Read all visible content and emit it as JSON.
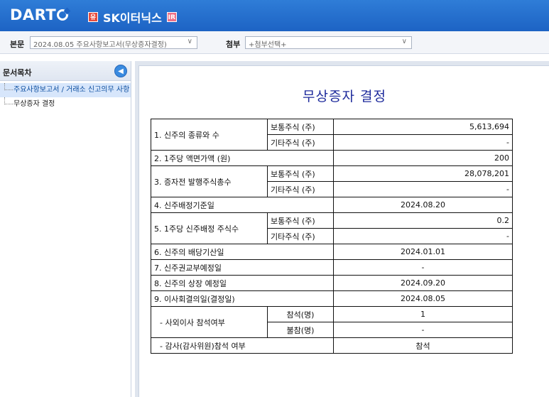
{
  "header": {
    "logo": "DART",
    "company": "SK이터닉스",
    "badge_left": "유",
    "badge_right": "IR"
  },
  "toolbar": {
    "main_label": "본문",
    "main_select": "2024.08.05  주요사항보고서(무상증자결정)",
    "attach_label": "첨부",
    "attach_select": "+첨부선택+"
  },
  "sidebar": {
    "title": "문서목차",
    "items": [
      {
        "label": "주요사항보고서 / 거래소 신고의무 사항"
      },
      {
        "label": "무상증자 결정"
      }
    ]
  },
  "document": {
    "title": "무상증자 결정",
    "rows": {
      "r1": {
        "label": "1. 신주의 종류와 수",
        "a_label": "보통주식 (주)",
        "a_val": "5,613,694",
        "b_label": "기타주식 (주)",
        "b_val": "-"
      },
      "r2": {
        "label": "2. 1주당 액면가액 (원)",
        "val": "200"
      },
      "r3": {
        "label": "3. 증자전 발행주식총수",
        "a_label": "보통주식 (주)",
        "a_val": "28,078,201",
        "b_label": "기타주식 (주)",
        "b_val": "-"
      },
      "r4": {
        "label": "4. 신주배정기준일",
        "val": "2024.08.20"
      },
      "r5": {
        "label": "5. 1주당 신주배정 주식수",
        "a_label": "보통주식 (주)",
        "a_val": "0.2",
        "b_label": "기타주식 (주)",
        "b_val": "-"
      },
      "r6": {
        "label": "6. 신주의 배당기산일",
        "val": "2024.01.01"
      },
      "r7": {
        "label": "7. 신주권교부예정일",
        "val": "-"
      },
      "r8": {
        "label": "8. 신주의 상장 예정일",
        "val": "2024.09.20"
      },
      "r9": {
        "label": "9. 이사회결의일(결정일)",
        "val": "2024.08.05"
      },
      "r10": {
        "label": "- 사외이사 참석여부",
        "a_label": "참석(명)",
        "a_val": "1",
        "b_label": "불참(명)",
        "b_val": "-"
      },
      "r11": {
        "label": "- 감사(감사위원)참석 여부",
        "val": "참석"
      }
    }
  }
}
